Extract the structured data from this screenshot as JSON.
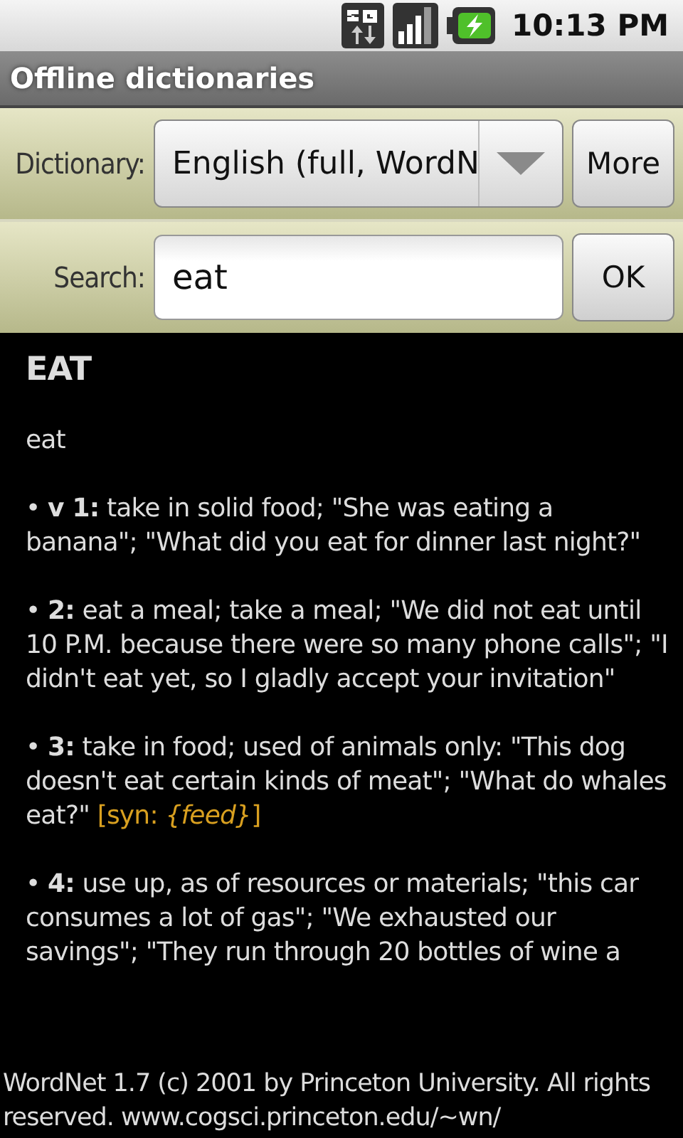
{
  "status_bar": {
    "time": "10:13 PM"
  },
  "window": {
    "title": "Offline dictionaries"
  },
  "dictionary": {
    "label": "Dictionary:",
    "value": "English (full, WordN",
    "more_button": "More"
  },
  "search": {
    "label": "Search:",
    "value": "eat",
    "ok_button": "OK"
  },
  "entry": {
    "headword": "EAT",
    "word": "eat",
    "senses": [
      {
        "text": "• **v 1:** take in solid food; \"She was eating a banana\"; \"What did you eat for dinner last night?\""
      },
      {
        "text": "• **2:** eat a meal; take a meal; \"We did not eat until 10 P.M. because there were so many phone calls\"; \"I didn't eat yet, so I gladly accept your invitation\""
      },
      {
        "text": "• **3:** take in food; used of animals only: \"This dog doesn't eat certain kinds of meat\"; \"What do whales eat?\"",
        "syn": "[syn: *{feed}*]"
      },
      {
        "text": "• **4:** use up, as of resources or materials; \"this car consumes a lot of gas\"; \"We exhausted our savings\"; \"They run through 20 bottles of wine a"
      }
    ]
  },
  "footer": "WordNet 1.7 (c) 2001 by Princeton University. All rights reserved. www.cogsci.princeton.edu/~wn/"
}
